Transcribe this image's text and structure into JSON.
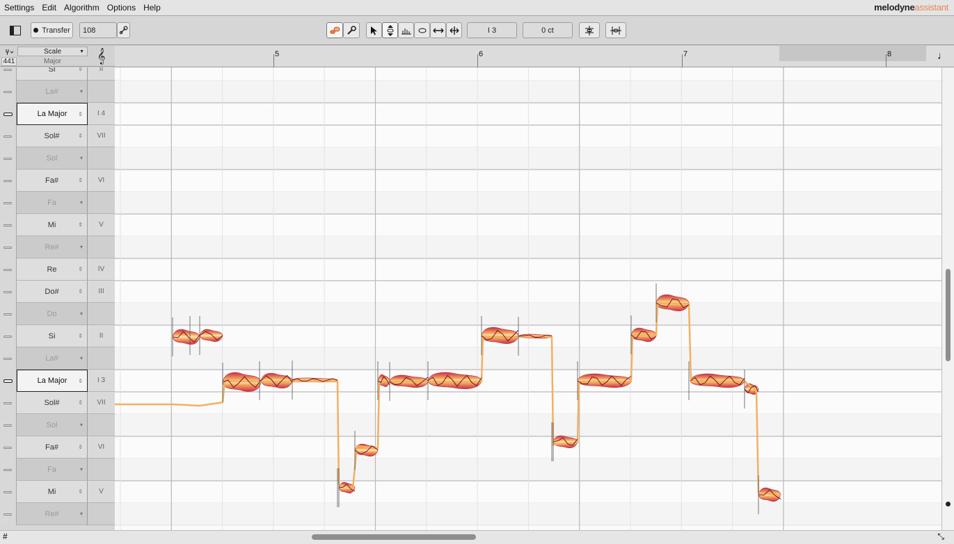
{
  "menu": {
    "items": [
      "Settings",
      "Edit",
      "Algorithm",
      "Options",
      "Help"
    ],
    "brand": "melodyne",
    "brand_suffix": "assistant"
  },
  "toolbar": {
    "transfer_label": "Transfer",
    "tempo_value": "108",
    "pitch_position": "I 3",
    "cent_offset": "0 ct",
    "tools": [
      "pitch-macro-icon",
      "wrench-icon",
      "pointer-tool-icon",
      "pitch-tool-icon",
      "formant-tool-icon",
      "amplitude-tool-icon",
      "timing-tool-icon",
      "time-stretch-tool-icon"
    ]
  },
  "scale_header": {
    "label": "Scale",
    "reference_pitch": "441",
    "mode": "Major"
  },
  "scale_rows": [
    {
      "name": "Si",
      "degree": "II",
      "type": "white"
    },
    {
      "name": "La#",
      "degree": "",
      "type": "black"
    },
    {
      "name": "La Major",
      "degree": "I 4",
      "type": "root"
    },
    {
      "name": "Sol#",
      "degree": "VII",
      "type": "white"
    },
    {
      "name": "Sol",
      "degree": "",
      "type": "black"
    },
    {
      "name": "Fa#",
      "degree": "VI",
      "type": "white"
    },
    {
      "name": "Fa",
      "degree": "",
      "type": "black"
    },
    {
      "name": "Mi",
      "degree": "V",
      "type": "white"
    },
    {
      "name": "Re#",
      "degree": "",
      "type": "black"
    },
    {
      "name": "Re",
      "degree": "IV",
      "type": "white"
    },
    {
      "name": "Do#",
      "degree": "III",
      "type": "white"
    },
    {
      "name": "Do",
      "degree": "",
      "type": "black"
    },
    {
      "name": "Si",
      "degree": "II",
      "type": "white"
    },
    {
      "name": "La#",
      "degree": "",
      "type": "black"
    },
    {
      "name": "La Major",
      "degree": "I 3",
      "type": "root"
    },
    {
      "name": "Sol#",
      "degree": "VII",
      "type": "white"
    },
    {
      "name": "Sol",
      "degree": "",
      "type": "black"
    },
    {
      "name": "Fa#",
      "degree": "VI",
      "type": "white"
    },
    {
      "name": "Fa",
      "degree": "",
      "type": "black"
    },
    {
      "name": "Mi",
      "degree": "V",
      "type": "white"
    },
    {
      "name": "Re#",
      "degree": "",
      "type": "black"
    }
  ],
  "ruler": {
    "bars": [
      "5",
      "6",
      "7",
      "8"
    ]
  },
  "colors": {
    "blob_fill": "#f4c57a",
    "blob_edge": "#c9324a",
    "pitch_line": "#f2b062",
    "pitch_curve": "#7a1222"
  }
}
